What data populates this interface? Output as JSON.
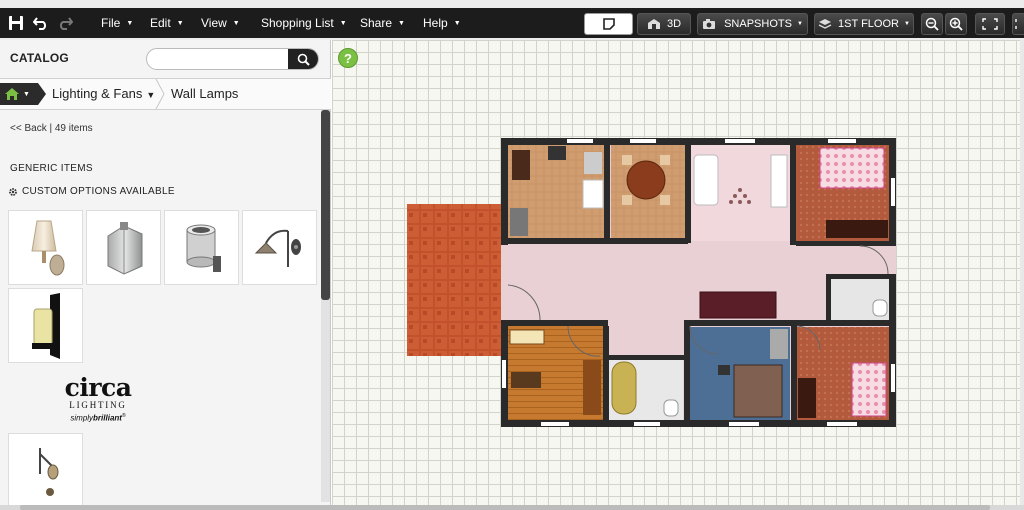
{
  "toolbar": {
    "menus": [
      {
        "label": "File"
      },
      {
        "label": "Edit"
      },
      {
        "label": "View"
      },
      {
        "label": "Shopping List"
      },
      {
        "label": "Share"
      },
      {
        "label": "Help"
      }
    ],
    "view_3d_label": "3D",
    "snapshots_label": "SNAPSHOTS",
    "floor_label": "1ST FLOOR"
  },
  "catalog": {
    "title": "CATALOG",
    "search": {
      "value": "",
      "placeholder": ""
    },
    "breadcrumb": [
      "Lighting & Fans",
      "Wall Lamps"
    ],
    "back_label": "<< Back",
    "item_count": "49 items",
    "generic_title": "GENERIC ITEMS",
    "custom_options": "CUSTOM OPTIONS AVAILABLE",
    "thumbnails": [
      {
        "icon": "wall-sconce-shade-icon"
      },
      {
        "icon": "wall-lantern-box-icon"
      },
      {
        "icon": "cylinder-sconce-icon"
      },
      {
        "icon": "swing-arm-lamp-icon"
      },
      {
        "icon": "candle-sconce-icon"
      },
      {
        "icon": "arm-wall-lamp-icon"
      }
    ],
    "brand": {
      "name": "circa",
      "sub": "LIGHTING",
      "tagline_1": "simply",
      "tagline_2": "brilliant",
      "mark": "®"
    }
  },
  "floorplan": {
    "floor": "1ST FLOOR",
    "colors": {
      "wall": "#2a2a2a",
      "living_floor": "#e9d0d4",
      "patio": "#c2512c",
      "kitchen_floor": "#c89466",
      "bedroom_carpet": "#4d6f96",
      "brick": "#b35a3d",
      "grid": "#d2d4cc"
    }
  }
}
